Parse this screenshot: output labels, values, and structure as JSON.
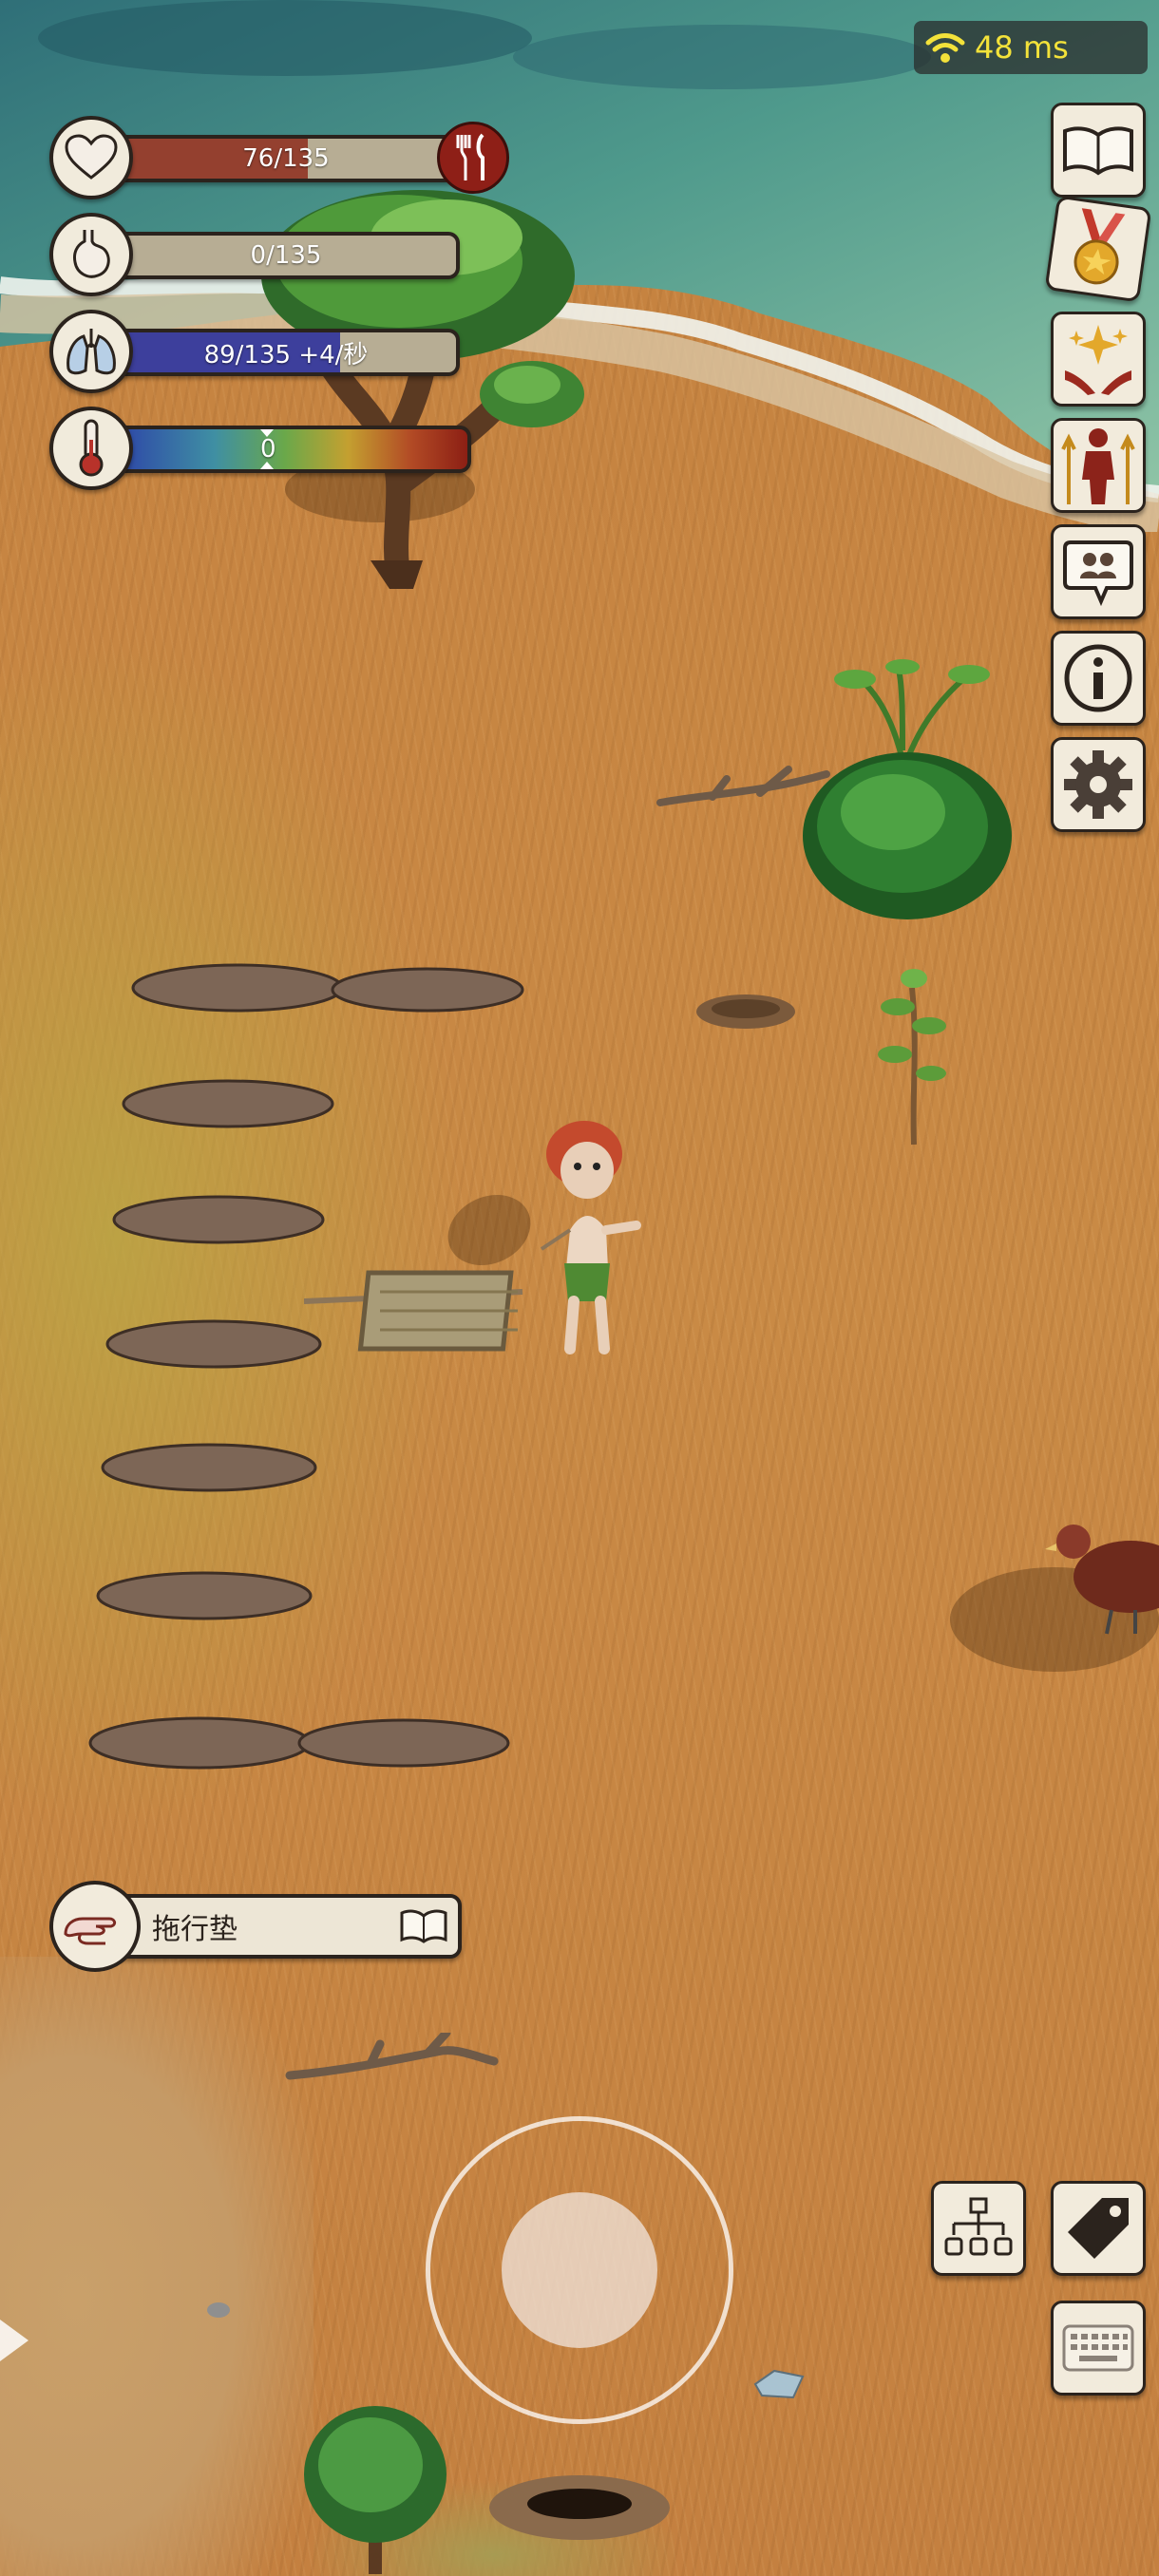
{
  "hud": {
    "stats": [
      {
        "name": "health",
        "icon": "heart-icon",
        "value": 76,
        "max": 135,
        "text": "76/135",
        "fill_color": "#94402f"
      },
      {
        "name": "hunger",
        "icon": "stomach-icon",
        "value": 0,
        "max": 135,
        "text": "0/135",
        "fill_color": "#a8a088"
      },
      {
        "name": "oxygen",
        "icon": "lungs-icon",
        "value": 89,
        "max": 135,
        "text": "89/135 +4/秒",
        "fill_color": "#3d3f9c"
      },
      {
        "name": "temperature",
        "icon": "thermometer-icon",
        "text": "0"
      }
    ],
    "eat_button_icon": "fork-knife-icon",
    "ping": {
      "text": "48 ms",
      "icon": "wifi-icon"
    },
    "side_buttons": [
      "book-icon",
      "medal-icon",
      "sparkle-hands-icon",
      "character-stats-icon",
      "chat-icon",
      "info-icon",
      "settings-icon"
    ],
    "bottom_buttons": [
      "tech-tree-icon",
      "tag-icon",
      "keyboard-icon"
    ],
    "craft": {
      "label": "拖行垫",
      "icon": "hand-icon",
      "book_icon": "recipe-book-icon"
    }
  },
  "world": {
    "entities": [
      "tree",
      "bush",
      "sapling",
      "character",
      "drag-mat",
      "bird",
      "dead-animals",
      "branch",
      "stone",
      "hole"
    ]
  },
  "colors": {
    "accent_red": "#8e1f17",
    "ping_text": "#f3e23a"
  }
}
